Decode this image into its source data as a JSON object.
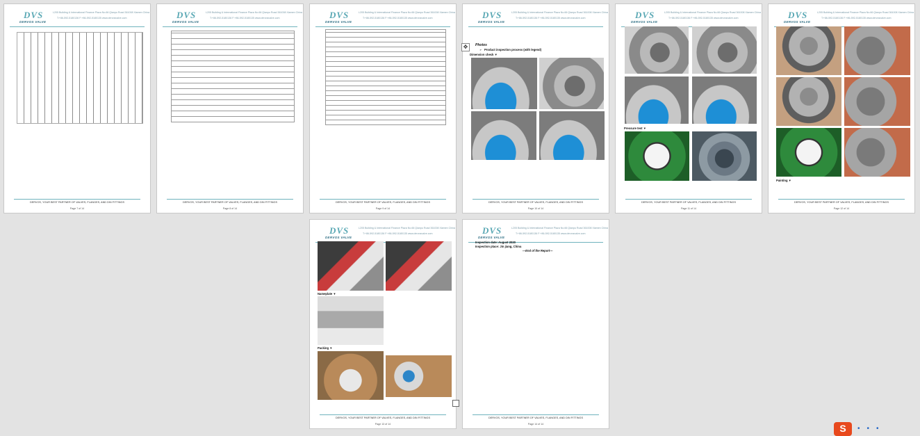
{
  "header": {
    "logo_text": "DVS",
    "logo_sub": "DERVOS VALVE",
    "address": "L205 Building & International Finance Plaza No.66 Qianpu Road 361008 Xiamen China",
    "contact": "T:+86-592-5180136   F:+86-592-5180135   www.dervosvalve.com"
  },
  "footer": {
    "slogan": "DERVOS, YOUR BEST PARTNER OF VALVES, FLANGES, AND DIN FITTINGS"
  },
  "pages": [
    {
      "page_no": "Page 7 of 14"
    },
    {
      "page_no": "Page 8 of 14"
    },
    {
      "page_no": "Page 9 of 14"
    },
    {
      "page_no": "Page 10 of 14"
    },
    {
      "page_no": "Page 11 of 14"
    },
    {
      "page_no": "Page 12 of 14"
    },
    {
      "page_no": "Page 13 of 14"
    },
    {
      "page_no": "Page 14 of 14"
    }
  ],
  "page10": {
    "photos_heading": "Photos",
    "bullet": "➢",
    "bullet_text": "Product inspection process (with legend)",
    "dimension_label": "Dimension check ▼"
  },
  "page11": {
    "pressure_label": "Pressure test ▼"
  },
  "page12": {
    "painting_label": "Painting ▼"
  },
  "page13": {
    "nameplate_label": "Nameplate ▼",
    "packing_label": "Packing ▼"
  },
  "page14": {
    "inspection_date": "Inspection date: August  2020",
    "inspection_place": "Inspection place: Jin jiang, China",
    "end_of_report": "---End of the Report---"
  },
  "ui": {
    "move_handle_icon": "✥",
    "tray_letter": "S"
  }
}
